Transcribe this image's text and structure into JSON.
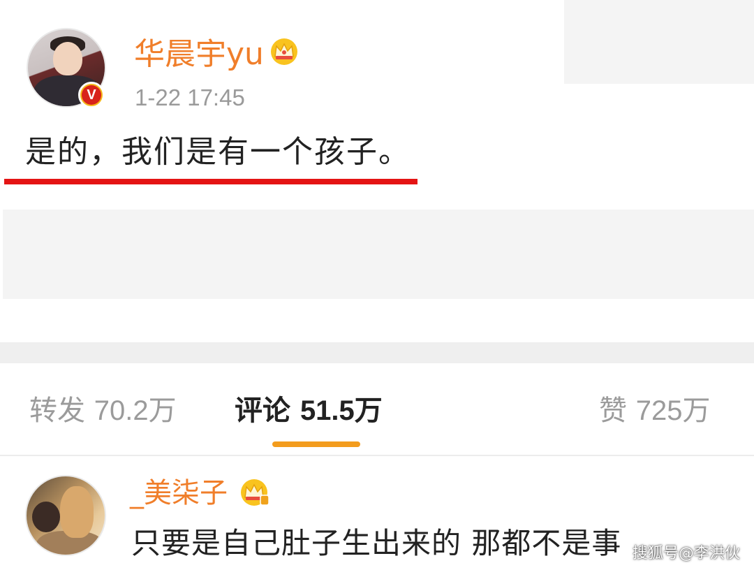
{
  "post": {
    "username": "华晨宇yu",
    "timestamp": "1-22 17:45",
    "text": "是的，我们是有一个孩子。"
  },
  "icons": {
    "verified_badge": "verified-v-icon",
    "verified_letter": "V",
    "member_crown": "crown-icon"
  },
  "tabs": {
    "repost": {
      "label": "转发",
      "count": "70.2万"
    },
    "comment": {
      "label": "评论",
      "count": "51.5万"
    },
    "like": {
      "label": "赞",
      "count": "725万"
    }
  },
  "comment": {
    "username": "_美柒子",
    "text": "只要是自己肚子生出来的 那都不是事"
  },
  "watermark": "搜狐号@李洪伙",
  "colors": {
    "username": "#f07e2a",
    "highlight_underline": "#e41414",
    "tab_indicator": "#f39c1d",
    "verified_red": "#d8231b",
    "verified_gold": "#f5b81c"
  }
}
